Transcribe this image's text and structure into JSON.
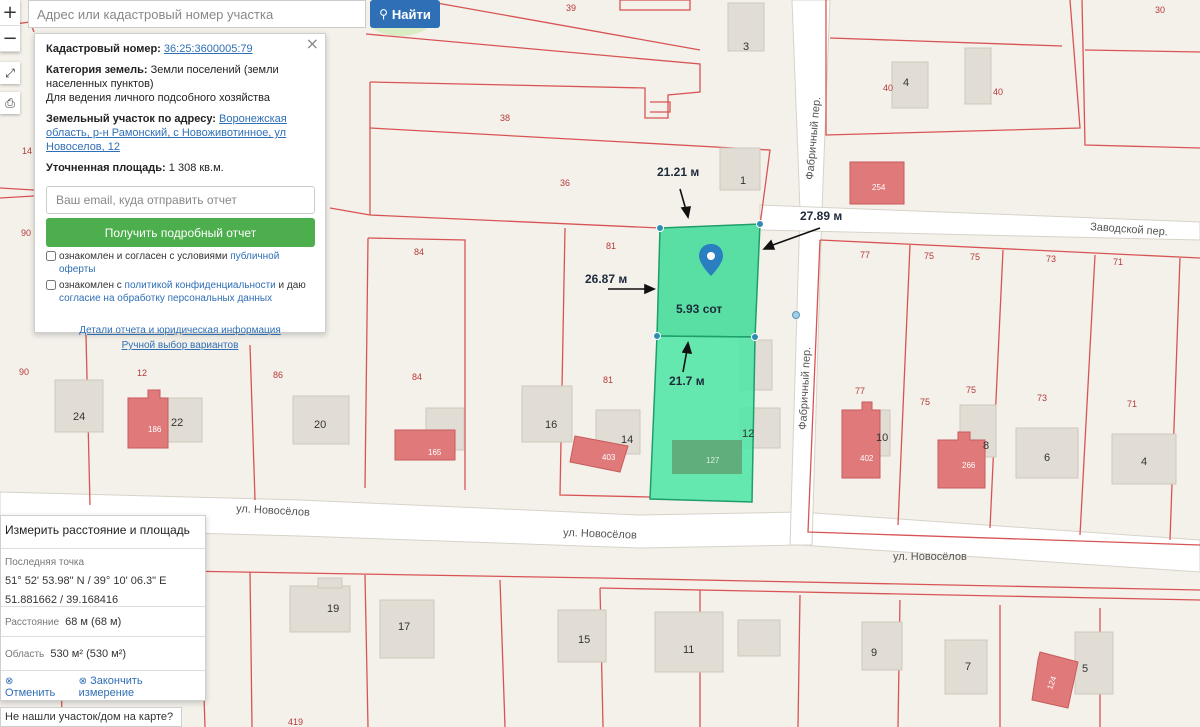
{
  "search": {
    "placeholder": "Адрес или кадастровый номер участка",
    "button_label": "Найти"
  },
  "controls": {
    "zoom_in": "+",
    "zoom_out": "−",
    "icons": [
      "fullscreen-icon",
      "print-icon"
    ]
  },
  "popup": {
    "cadastral_label": "Кадастровый номер:",
    "cadastral_number": "36:25:3600005:79",
    "category_label": "Категория земель:",
    "category_value": "Земли поселений (земли населенных пунктов)",
    "use_value": "Для ведения личного подсобного хозяйства",
    "address_label": "Земельный участок по адресу:",
    "address_value": "Воронежская область, р-н Рамонский, с Новоживотинное, ул Новоселов, 12",
    "area_label": "Уточненная площадь:",
    "area_value": "1 308 кв.м.",
    "email_placeholder": "Ваш email, куда отправить отчет",
    "report_button": "Получить подробный отчет",
    "consent1_text": "ознакомлен и согласен с условиями",
    "consent1_link": "публичной оферты",
    "consent2_text": "ознакомлен с",
    "consent2_link": "политикой конфиденциальности",
    "consent2_text_after": "и даю",
    "consent2_link2": "согласие на обработку персональных данных",
    "details_link": "Детали отчета и юридическая информация",
    "manual_link": "Ручной выбор вариантов"
  },
  "measure": {
    "title": "Измерить расстояние и площадь",
    "last_point_label": "Последняя точка",
    "coords_dms": "51° 52' 53.98\" N / 39° 10' 06.3\" E",
    "coords_decimal": "51.881662 / 39.168416",
    "distance_label": "Расстояние",
    "distance_value": "68 м (68 м)",
    "area_label": "Область",
    "area_value": "530 м² (530 м²)",
    "cancel": "Отменить",
    "finish": "Закончить измерение"
  },
  "not_found": "Не нашли участок/дом на карте?",
  "map": {
    "dimensions": {
      "top": "21.21 м",
      "right": "27.89 м",
      "left": "26.87 м",
      "bottom": "21.7 м",
      "area": "5.93 сот"
    },
    "streets": {
      "novoselov_1": "ул. Новосёлов",
      "novoselov_2": "ул. Новосёлов",
      "novoselov_3": "ул. Новосёлов",
      "fabrichny_1": "Фабричный пер.",
      "fabrichny_2": "Фабричный пер.",
      "zavodskoy": "Заводской пер."
    },
    "house_numbers": {
      "h3": "3",
      "h4": "4",
      "h1": "1",
      "h24": "24",
      "h22": "22",
      "h20": "20",
      "h16": "16",
      "h14": "14",
      "h12": "12",
      "h10": "10",
      "h8": "8",
      "h6": "6",
      "h4b": "4",
      "h19": "19",
      "h17": "17",
      "h15": "15",
      "h11": "11",
      "h9": "9",
      "h7": "7",
      "h5": "5"
    },
    "parcel_numbers": {
      "p39": "39",
      "p30": "30",
      "p40a": "40",
      "p40b": "40",
      "p38": "38",
      "p36": "36",
      "p14": "14",
      "p90a": "90",
      "p90b": "90",
      "p84a": "84",
      "p84b": "84",
      "p81a": "81",
      "p81b": "81",
      "p12": "12",
      "p86": "86",
      "p77a": "77",
      "p77b": "77",
      "p75a": "75",
      "p75b": "75",
      "p75c": "75",
      "p75d": "75",
      "p73a": "73",
      "p73b": "73",
      "p71a": "71",
      "p71b": "71",
      "p419": "419"
    },
    "building_numbers": {
      "b254": "254",
      "b186": "186",
      "b165": "165",
      "b403": "403",
      "b127": "127",
      "b402": "402",
      "b266": "266",
      "b124": "124"
    }
  }
}
